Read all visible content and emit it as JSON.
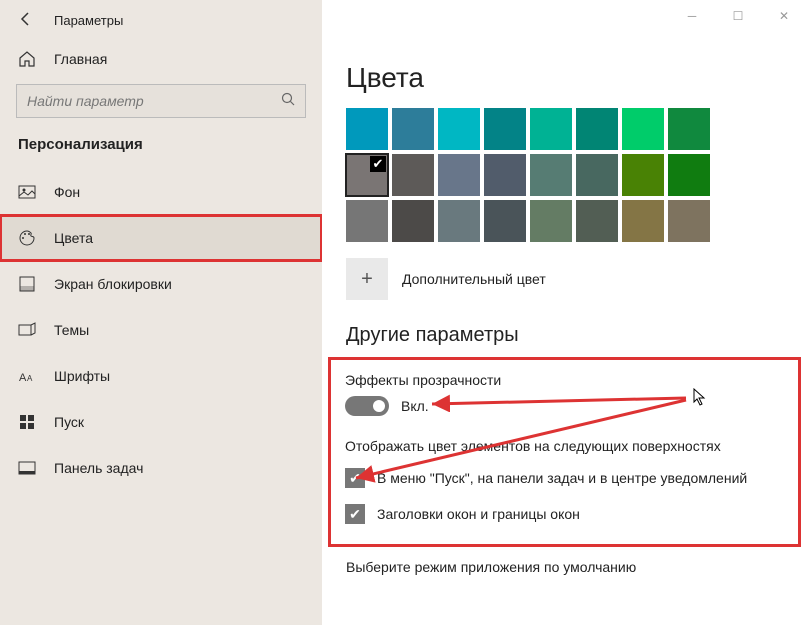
{
  "titlebar": {
    "title": "Параметры"
  },
  "sidebar": {
    "home": "Главная",
    "search_placeholder": "Найти параметр",
    "section": "Персонализация",
    "items": [
      {
        "label": "Фон"
      },
      {
        "label": "Цвета"
      },
      {
        "label": "Экран блокировки"
      },
      {
        "label": "Темы"
      },
      {
        "label": "Шрифты"
      },
      {
        "label": "Пуск"
      },
      {
        "label": "Панель задач"
      }
    ]
  },
  "page": {
    "title": "Цвета",
    "colors": {
      "row1": [
        "#0099bc",
        "#2d7d9a",
        "#00b7c3",
        "#038387",
        "#00b294",
        "#018574",
        "#00cc6a",
        "#10893e"
      ],
      "row2": [
        "#7a7574",
        "#5d5a58",
        "#68768a",
        "#515c6b",
        "#567c73",
        "#486860",
        "#498205",
        "#107c10"
      ],
      "row3": [
        "#767676",
        "#4c4a48",
        "#69797e",
        "#4a5459",
        "#647c64",
        "#525e54",
        "#847545",
        "#7e735f"
      ]
    },
    "selected_color_index": {
      "row": 1,
      "col": 0
    },
    "custom_color": "Дополнительный цвет",
    "subheader": "Другие параметры",
    "transparency_label": "Эффекты прозрачности",
    "toggle_state": "Вкл.",
    "accent_surfaces_label": "Отображать цвет элементов на следующих поверхностях",
    "chk1": "В меню \"Пуск\", на панели задач и в центре уведомлений",
    "chk2": "Заголовки окон и границы окон",
    "app_mode": "Выберите режим приложения по умолчанию"
  }
}
